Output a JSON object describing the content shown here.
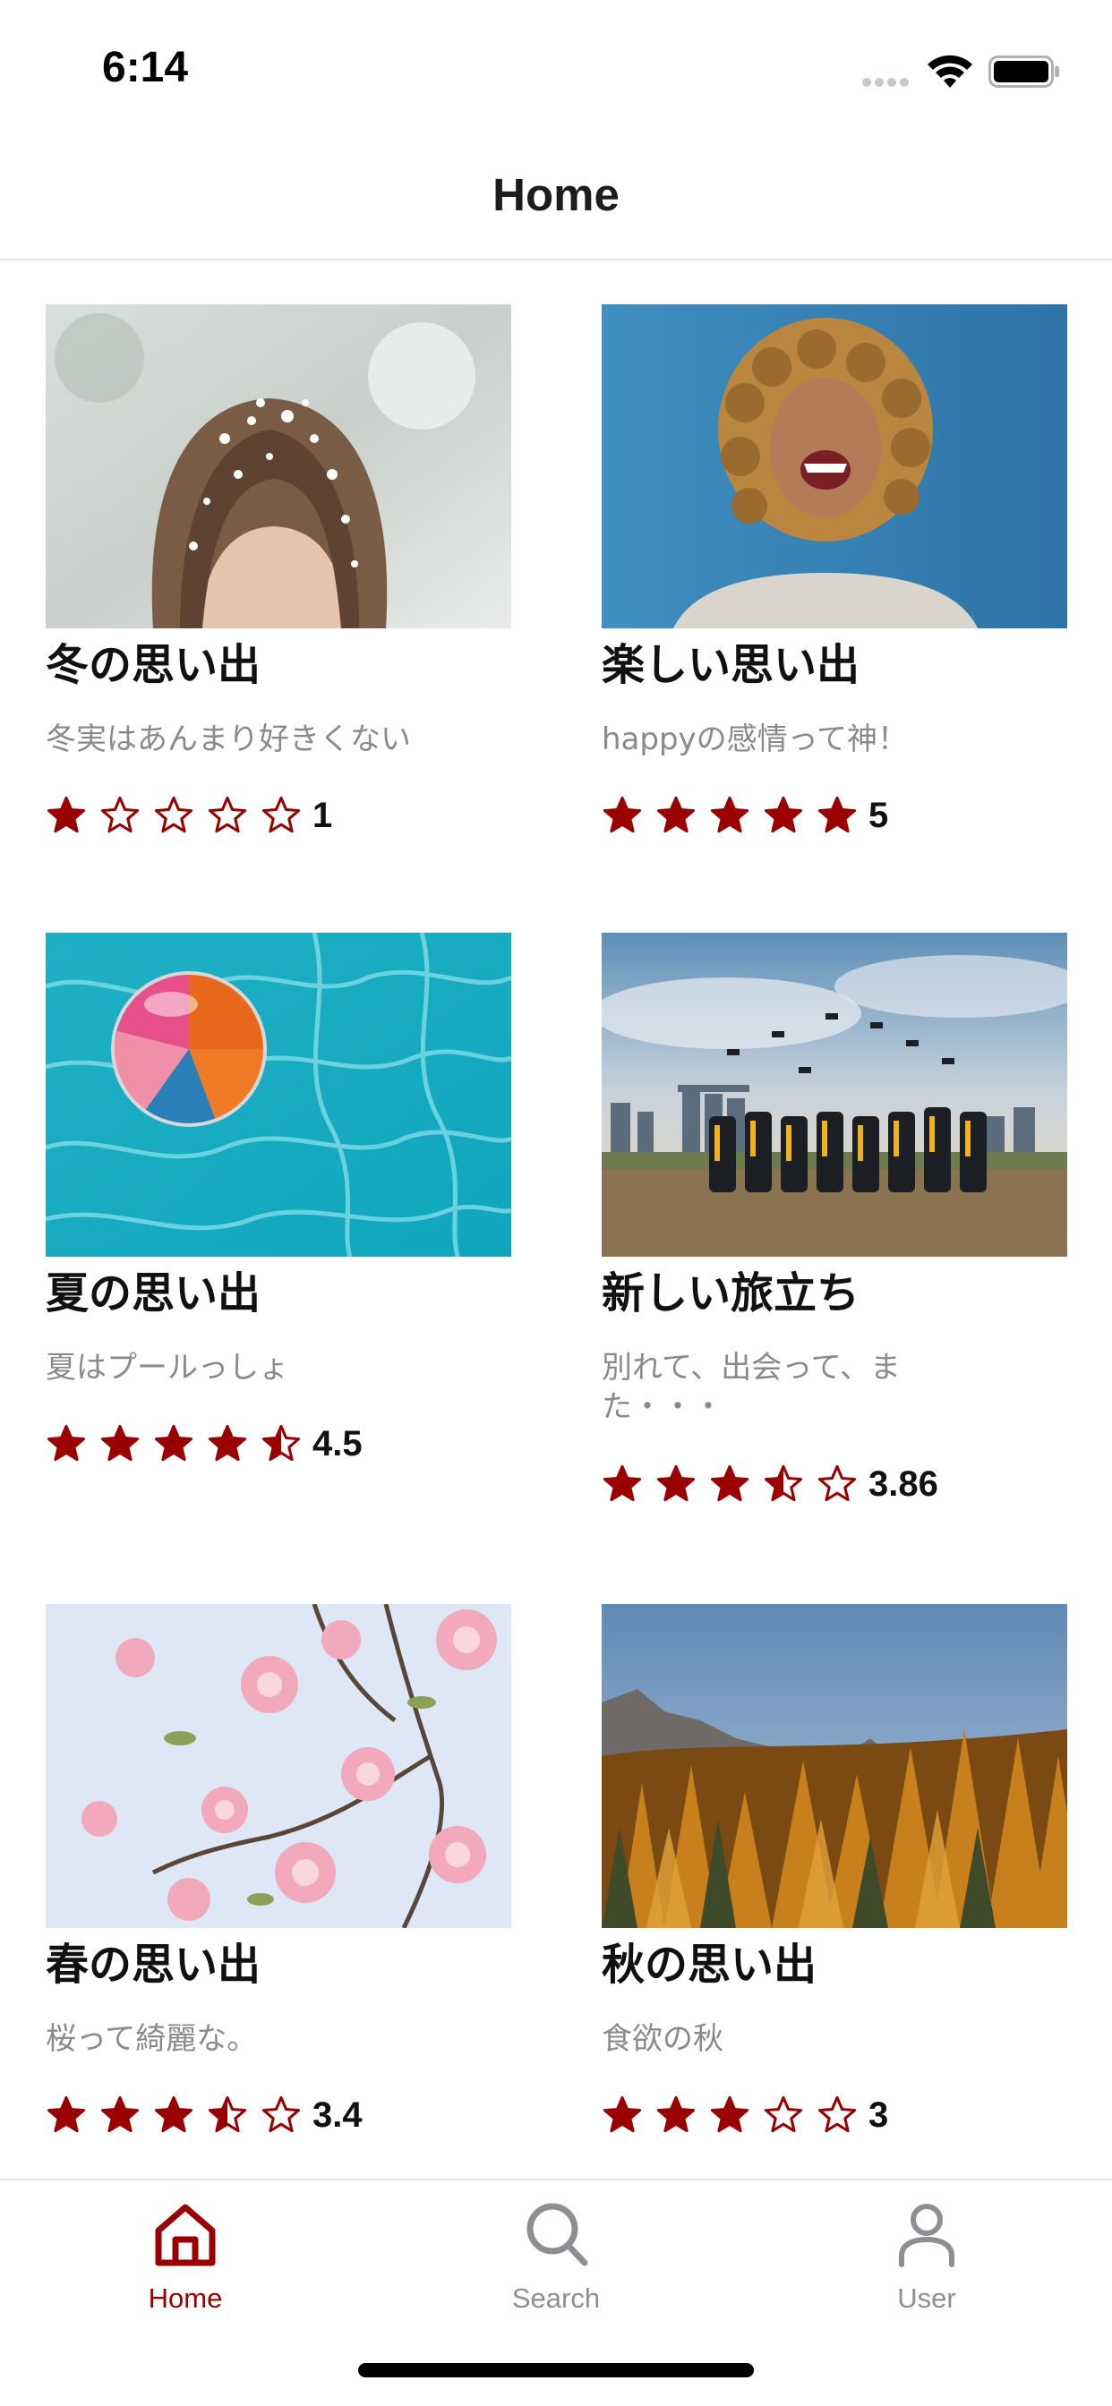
{
  "status_bar": {
    "time": "6:14"
  },
  "nav": {
    "title": "Home"
  },
  "colors": {
    "accent": "#9b0000",
    "inactive": "#8e8e93",
    "star_filled": "#9b0000"
  },
  "cards": [
    {
      "title": "冬の思い出",
      "description": "冬実はあんまり好きくない",
      "rating": 1,
      "rating_label": "1",
      "image": "snow-hair-photo"
    },
    {
      "title": "楽しい思い出",
      "description": "happyの感情って神！",
      "rating": 5,
      "rating_label": "5",
      "image": "curly-hair-laughing-photo"
    },
    {
      "title": "夏の思い出",
      "description": "夏はプールっしょ",
      "rating": 4.5,
      "rating_label": "4.5",
      "image": "beach-ball-pool-photo"
    },
    {
      "title": "新しい旅立ち",
      "description": "別れて、出会って、また・・・",
      "rating": 3.86,
      "rating_label": "3.86",
      "image": "graduation-caps-photo"
    },
    {
      "title": "春の思い出",
      "description": "桜って綺麗な。",
      "rating": 3.4,
      "rating_label": "3.4",
      "image": "blossom-branch-photo"
    },
    {
      "title": "秋の思い出",
      "description": "食欲の秋",
      "rating": 3,
      "rating_label": "3",
      "image": "autumn-forest-photo"
    }
  ],
  "tabs": [
    {
      "label": "Home",
      "icon": "home-icon",
      "active": true
    },
    {
      "label": "Search",
      "icon": "search-icon",
      "active": false
    },
    {
      "label": "User",
      "icon": "user-icon",
      "active": false
    }
  ]
}
